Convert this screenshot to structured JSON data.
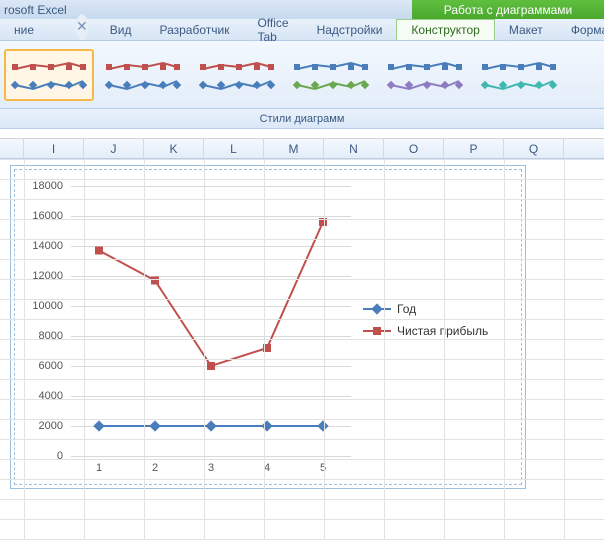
{
  "app": {
    "title": "rosoft Excel"
  },
  "tools_title": "Работа с диаграммами",
  "tabs": {
    "left": [
      "ние",
      "Вид",
      "Разработчик",
      "Office Tab",
      "Надстройки"
    ],
    "right": [
      "Конструктор",
      "Макет",
      "Формат"
    ],
    "active": "Конструктор"
  },
  "ribbon": {
    "group_label": "Стили диаграмм"
  },
  "columns": [
    "I",
    "J",
    "K",
    "L",
    "M",
    "N",
    "O",
    "P",
    "Q"
  ],
  "style_colors": [
    [
      "#4a7ebb",
      "#c0504d"
    ],
    [
      "#4a7ebb",
      "#c0504d"
    ],
    [
      "#4a7ebb",
      "#c0504d"
    ],
    [
      "#6aa84f",
      "#4a7ebb"
    ],
    [
      "#8e7cc3",
      "#4a7ebb"
    ],
    [
      "#3fb8af",
      "#4a7ebb"
    ]
  ],
  "chart_data": {
    "type": "line",
    "categories": [
      1,
      2,
      3,
      4,
      5
    ],
    "series": [
      {
        "name": "Год",
        "values": [
          2000,
          2000,
          2000,
          2000,
          2000
        ],
        "color": "#4a7ebb",
        "marker": "diamond"
      },
      {
        "name": "Чистая прибыль",
        "values": [
          13700,
          11700,
          6000,
          7200,
          15600
        ],
        "color": "#c0504d",
        "marker": "square"
      }
    ],
    "ylim": [
      0,
      18000
    ],
    "yticks": [
      0,
      2000,
      4000,
      6000,
      8000,
      10000,
      12000,
      14000,
      16000,
      18000
    ]
  }
}
